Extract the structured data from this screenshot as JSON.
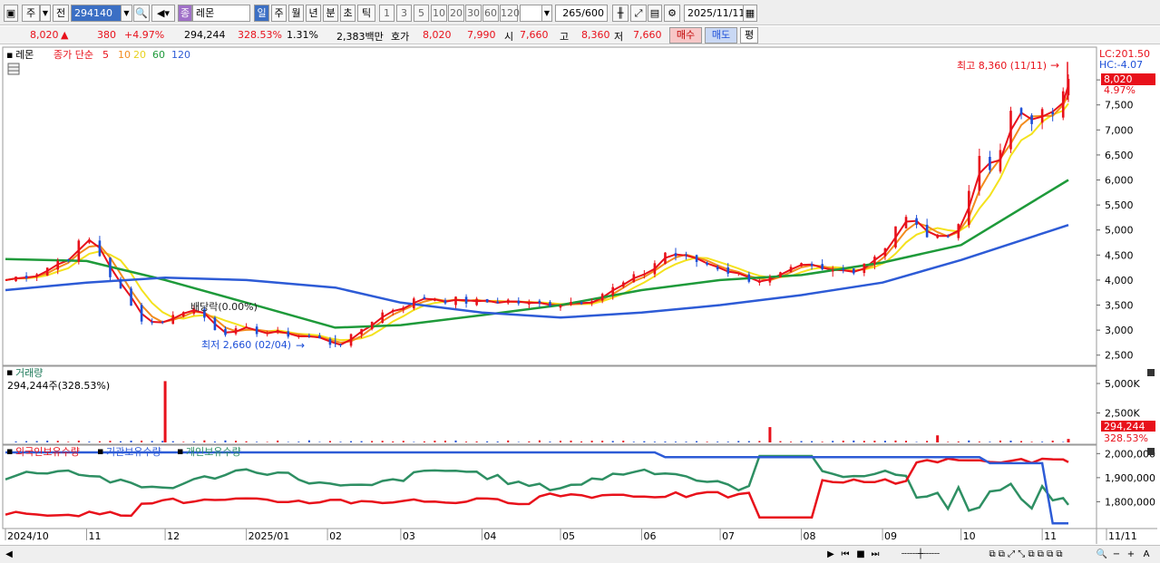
{
  "toolbar": {
    "market": "주",
    "prev_label": "전",
    "code": "294140",
    "name_badge": "종",
    "name": "레몬",
    "periods": [
      "일",
      "주",
      "월",
      "년",
      "분",
      "초",
      "틱"
    ],
    "selected_period": "일",
    "intervals": [
      "1",
      "3",
      "5",
      "10",
      "20",
      "30",
      "60",
      "120"
    ],
    "count": "265",
    "count_total": "/600",
    "date": "2025/11/11"
  },
  "quote": {
    "price": "8,020",
    "arrow": "▲",
    "change": "380",
    "change_pct": "+4.97%",
    "volume": "294,244",
    "volume_ratio": "328.53%",
    "turnover": "1.31%",
    "amount": "2,383백만",
    "hoga_label": "호가",
    "ask": "8,020",
    "bid": "7,990",
    "open_label": "시",
    "open": "7,660",
    "high_label": "고",
    "high": "8,360",
    "low_label": "저",
    "low": "7,660",
    "buy_label": "매수",
    "sell_label": "매도",
    "eval_label": "평"
  },
  "legend": {
    "stock": "레몬",
    "ma_label": "종가 단순",
    "ma_periods": [
      "5",
      "10",
      "20",
      "60",
      "120"
    ]
  },
  "colors": {
    "up": "#e8111b",
    "down": "#1d4fd8",
    "ma5": "#e8111b",
    "ma10": "#f28c1e",
    "ma20": "#f4e21e",
    "ma60": "#1e9a3a",
    "ma120": "#2d5bd6",
    "foreign": "#e8111b",
    "institution": "#2d5bd6",
    "individual": "#2e8f63"
  },
  "annotations": {
    "high": "최고 8,360 (11/11)",
    "low": "최저 2,660 (02/04)",
    "dividend": "배당락(0.00%)"
  },
  "right_labels": {
    "lc": "LC:201.50",
    "hc": "HC:-4.07",
    "last_price": "8,020",
    "last_pct": "4.97%",
    "last_volume": "294,244",
    "last_volume_pct": "328.53%"
  },
  "volume_panel": {
    "title": "거래량",
    "summary": "294,244주(328.53%)"
  },
  "holdings_panel": {
    "labels": [
      "외국인보유수량",
      "기관보유수량",
      "개인보유수량"
    ]
  },
  "chart_data": [
    {
      "type": "candlestick",
      "title": "레몬",
      "x_ticks": [
        "2024/10",
        "11",
        "12",
        "2025/01",
        "02",
        "03",
        "04",
        "05",
        "06",
        "07",
        "08",
        "09",
        "10",
        "11",
        "11/11"
      ],
      "y_ticks": [
        2500,
        3000,
        3500,
        4000,
        4500,
        5000,
        5500,
        6000,
        6500,
        7000,
        7500,
        8000
      ],
      "ylim": [
        2350,
        8600
      ],
      "y_axis_position": "right",
      "grid": false,
      "close_series": [
        [
          "2024-10-01",
          4000
        ],
        [
          "2024-10-15",
          4200
        ],
        [
          "2024-10-25",
          4500
        ],
        [
          "2024-11-01",
          4850
        ],
        [
          "2024-11-05",
          4600
        ],
        [
          "2024-11-10",
          4100
        ],
        [
          "2024-11-15",
          3700
        ],
        [
          "2024-11-20",
          3300
        ],
        [
          "2024-11-25",
          3150
        ],
        [
          "2024-12-01",
          3200
        ],
        [
          "2024-12-05",
          3300
        ],
        [
          "2024-12-10",
          3500
        ],
        [
          "2024-12-15",
          3300
        ],
        [
          "2024-12-20",
          3050
        ],
        [
          "2024-12-25",
          2950
        ],
        [
          "2025-01-01",
          3000
        ],
        [
          "2025-01-10",
          2950
        ],
        [
          "2025-01-20",
          2900
        ],
        [
          "2025-01-27",
          2850
        ],
        [
          "2025-02-04",
          2700
        ],
        [
          "2025-02-10",
          2850
        ],
        [
          "2025-02-20",
          3300
        ],
        [
          "2025-03-01",
          3500
        ],
        [
          "2025-03-10",
          3650
        ],
        [
          "2025-03-20",
          3600
        ],
        [
          "2025-04-01",
          3550
        ],
        [
          "2025-04-10",
          3600
        ],
        [
          "2025-04-20",
          3500
        ],
        [
          "2025-05-01",
          3550
        ],
        [
          "2025-05-10",
          3600
        ],
        [
          "2025-05-20",
          3800
        ],
        [
          "2025-06-01",
          4100
        ],
        [
          "2025-06-10",
          4550
        ],
        [
          "2025-06-20",
          4400
        ],
        [
          "2025-07-01",
          4250
        ],
        [
          "2025-07-10",
          4050
        ],
        [
          "2025-07-20",
          4000
        ],
        [
          "2025-08-01",
          4250
        ],
        [
          "2025-08-10",
          4150
        ],
        [
          "2025-08-20",
          4200
        ],
        [
          "2025-09-01",
          4600
        ],
        [
          "2025-09-08",
          5300
        ],
        [
          "2025-09-15",
          5000
        ],
        [
          "2025-09-22",
          4800
        ],
        [
          "2025-10-01",
          5200
        ],
        [
          "2025-10-08",
          6500
        ],
        [
          "2025-10-15",
          6200
        ],
        [
          "2025-10-20",
          7400
        ],
        [
          "2025-10-27",
          7000
        ],
        [
          "2025-11-03",
          7600
        ],
        [
          "2025-11-07",
          7300
        ],
        [
          "2025-11-11",
          8020
        ]
      ],
      "moving_averages": {
        "ma60": [
          [
            "2024-10-01",
            4420
          ],
          [
            "2024-11-01",
            4380
          ],
          [
            "2024-12-01",
            4000
          ],
          [
            "2025-01-01",
            3550
          ],
          [
            "2025-02-04",
            3050
          ],
          [
            "2025-03-01",
            3100
          ],
          [
            "2025-04-01",
            3300
          ],
          [
            "2025-05-01",
            3500
          ],
          [
            "2025-06-01",
            3800
          ],
          [
            "2025-07-01",
            4000
          ],
          [
            "2025-08-01",
            4100
          ],
          [
            "2025-09-01",
            4350
          ],
          [
            "2025-10-01",
            4700
          ],
          [
            "2025-11-11",
            6000
          ]
        ],
        "ma120": [
          [
            "2024-10-01",
            3800
          ],
          [
            "2024-11-01",
            3950
          ],
          [
            "2024-12-01",
            4050
          ],
          [
            "2025-01-01",
            4000
          ],
          [
            "2025-02-04",
            3850
          ],
          [
            "2025-03-01",
            3550
          ],
          [
            "2025-04-01",
            3350
          ],
          [
            "2025-05-01",
            3250
          ],
          [
            "2025-06-01",
            3350
          ],
          [
            "2025-07-01",
            3500
          ],
          [
            "2025-08-01",
            3700
          ],
          [
            "2025-09-01",
            3950
          ],
          [
            "2025-10-01",
            4400
          ],
          [
            "2025-11-11",
            5100
          ]
        ]
      },
      "high_annotation": {
        "date": "2025-11-11",
        "value": 8360
      },
      "low_annotation": {
        "date": "2025-02-04",
        "value": 2660
      }
    },
    {
      "type": "bar",
      "title": "거래량",
      "y_ticks": [
        "2,500K",
        "5,000K"
      ],
      "ylim": [
        0,
        6000000
      ],
      "spikes": [
        [
          "2024-12-01",
          5200000
        ],
        [
          "2025-07-20",
          1300000
        ],
        [
          "2025-09-22",
          600000
        ],
        [
          "2025-11-11",
          294244
        ]
      ]
    },
    {
      "type": "line",
      "series": [
        {
          "name": "외국인보유수량",
          "color": "#e8111b"
        },
        {
          "name": "기관보유수량",
          "color": "#2d5bd6"
        },
        {
          "name": "개인보유수량",
          "color": "#2e8f63"
        }
      ],
      "y_ticks": [
        "1,800,000",
        "1,900,000",
        "2,000,000"
      ],
      "ylim": [
        1700000,
        2020000
      ]
    }
  ]
}
